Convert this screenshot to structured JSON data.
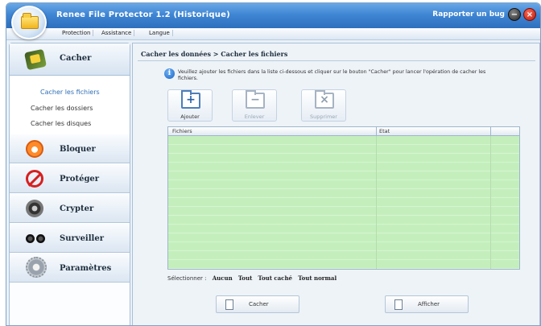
{
  "window": {
    "title": "Renee File Protector 1.2 (Historique)",
    "report_bug": "Rapporter un bug",
    "minimize": "−",
    "close": "×"
  },
  "menu": [
    "Protection",
    "Assistance",
    "Langue"
  ],
  "sidebar": {
    "head_label": "Cacher",
    "sub_items": [
      "Cacher les fichiers",
      "Cacher les dossiers",
      "Cacher les disques"
    ],
    "nav": [
      {
        "label": "Bloquer",
        "icon": "lock-icon"
      },
      {
        "label": "Protéger",
        "icon": "prohibit-icon"
      },
      {
        "label": "Crypter",
        "icon": "disc-icon"
      },
      {
        "label": "Surveiller",
        "icon": "binoculars-icon"
      },
      {
        "label": "Paramètres",
        "icon": "gear-icon"
      }
    ]
  },
  "main": {
    "breadcrumb": "Cacher les données > Cacher les fichiers",
    "info_icon_glyph": "i",
    "info_text": "Veuillez ajouter les fichiers dans la liste ci-dessous et cliquer sur le bouton \"Cacher\" pour lancer l'opération de cacher les fichiers.",
    "toolbar": {
      "add_glyph": "+",
      "add_label": "Ajouter",
      "remove_glyph": "−",
      "remove_label": "Enlever",
      "delete_glyph": "×",
      "delete_label": "Supprimer"
    },
    "table": {
      "col_files": "Fichiers",
      "col_state": "Etat"
    },
    "select": {
      "label": "Sélectionner :",
      "options": [
        "Aucun",
        "Tout",
        "Tout caché",
        "Tout normal"
      ]
    },
    "buttons": {
      "hide": "Cacher",
      "show": "Afficher"
    }
  },
  "colors": {
    "title_bar": "#3f86d4",
    "table_bg": "#c7efc0",
    "active_link": "#2f6fb5"
  }
}
